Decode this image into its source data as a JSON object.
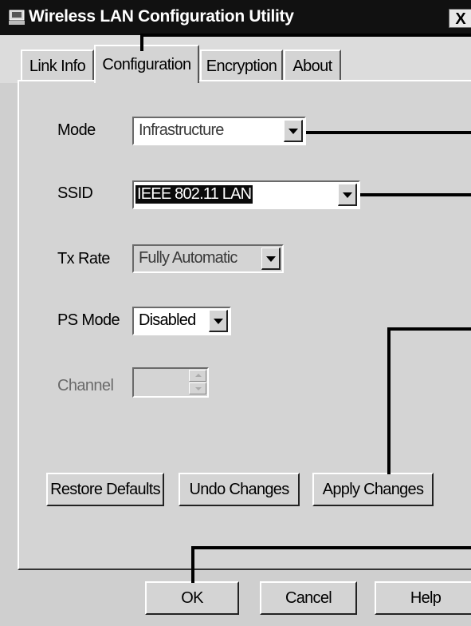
{
  "window": {
    "title": "Wireless LAN Configuration Utility",
    "close_label": "X"
  },
  "tabs": [
    {
      "label": "Link Info",
      "active": false
    },
    {
      "label": "Configuration",
      "active": true
    },
    {
      "label": "Encryption",
      "active": false
    },
    {
      "label": "About",
      "active": false
    }
  ],
  "config": {
    "mode": {
      "label": "Mode",
      "value": "Infrastructure"
    },
    "ssid": {
      "label": "SSID",
      "value": "IEEE 802.11 LAN"
    },
    "tx_rate": {
      "label": "Tx Rate",
      "value": "Fully Automatic"
    },
    "ps_mode": {
      "label": "PS Mode",
      "value": "Disabled"
    },
    "channel": {
      "label": "Channel",
      "value": ""
    }
  },
  "buttons": {
    "restore_defaults": "Restore Defaults",
    "undo_changes": "Undo Changes",
    "apply_changes": "Apply Changes",
    "ok": "OK",
    "cancel": "Cancel",
    "help": "Help"
  },
  "colors": {
    "titlebar": "#111111",
    "panel": "#d4d4d4",
    "selection": "#0a0a0a"
  }
}
